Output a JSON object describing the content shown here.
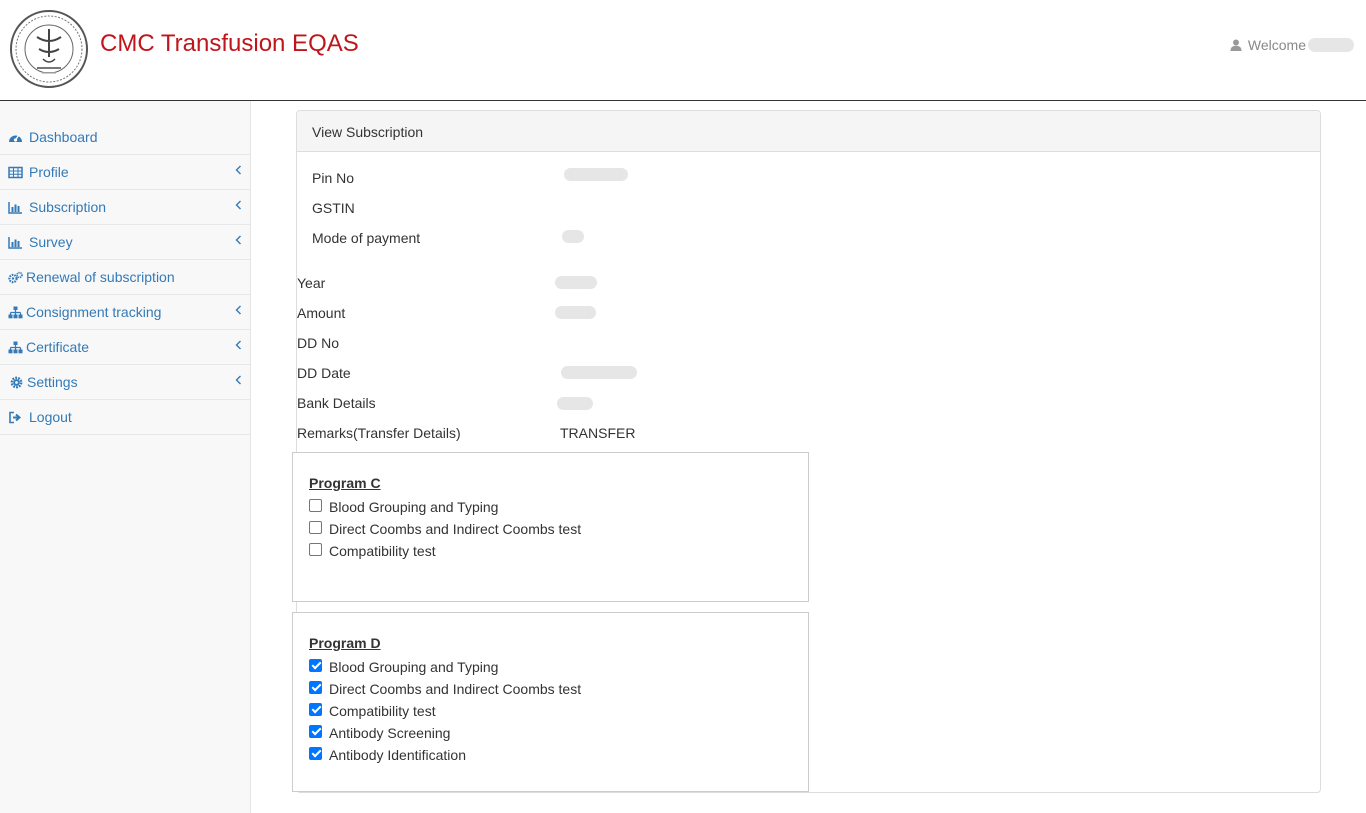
{
  "app": {
    "title": "CMC Transfusion EQAS",
    "welcome_label": "Welcome"
  },
  "sidebar": {
    "items": [
      {
        "label": "Dashboard",
        "icon": "dashboard-icon",
        "has_submenu": false
      },
      {
        "label": "Profile",
        "icon": "table-icon",
        "has_submenu": true
      },
      {
        "label": "Subscription",
        "icon": "bar-chart-icon",
        "has_submenu": true
      },
      {
        "label": "Survey",
        "icon": "bar-chart-icon",
        "has_submenu": true
      },
      {
        "label": "Renewal of subscription",
        "icon": "gears-icon",
        "has_submenu": false
      },
      {
        "label": "Consignment tracking",
        "icon": "sitemap-icon",
        "has_submenu": true
      },
      {
        "label": "Certificate",
        "icon": "sitemap-icon",
        "has_submenu": true
      },
      {
        "label": "Settings",
        "icon": "gear-icon",
        "has_submenu": true
      },
      {
        "label": "Logout",
        "icon": "sign-out-icon",
        "has_submenu": false
      }
    ]
  },
  "panel": {
    "heading": "View Subscription"
  },
  "fields": {
    "pin_no": {
      "label": "Pin No"
    },
    "gstin": {
      "label": "GSTIN"
    },
    "mode_of_payment": {
      "label": "Mode of payment"
    },
    "year": {
      "label": "Year"
    },
    "amount": {
      "label": "Amount"
    },
    "dd_no": {
      "label": "DD No"
    },
    "dd_date": {
      "label": "DD Date"
    },
    "bank_details": {
      "label": "Bank Details"
    },
    "remarks": {
      "label": "Remarks(Transfer Details)",
      "value": "TRANSFER"
    }
  },
  "programs": [
    {
      "title": "Program C",
      "tests": [
        {
          "label": "Blood Grouping and Typing",
          "checked": false
        },
        {
          "label": "Direct Coombs and Indirect Coombs test",
          "checked": false
        },
        {
          "label": "Compatibility test",
          "checked": false
        }
      ]
    },
    {
      "title": "Program D",
      "tests": [
        {
          "label": "Blood Grouping and Typing",
          "checked": true
        },
        {
          "label": "Direct Coombs and Indirect Coombs test",
          "checked": true
        },
        {
          "label": "Compatibility test",
          "checked": true
        },
        {
          "label": "Antibody Screening",
          "checked": true
        },
        {
          "label": "Antibody Identification",
          "checked": true
        }
      ]
    }
  ],
  "colors": {
    "brand_red": "#c0161b",
    "link_blue": "#337ab7",
    "checkbox_blue": "#0075ff"
  }
}
